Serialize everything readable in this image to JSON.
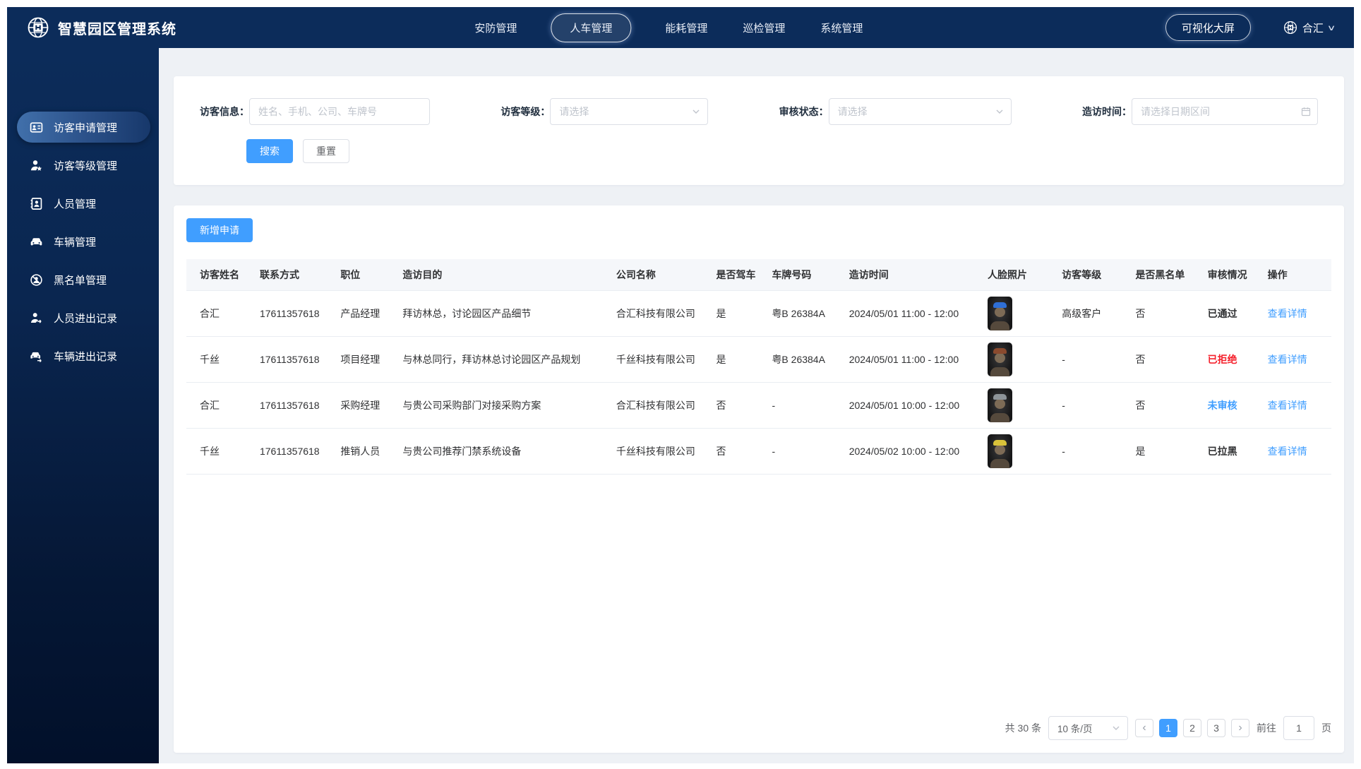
{
  "app": {
    "title": "智慧园区管理系统"
  },
  "colors": {
    "primary": "#409eff",
    "danger": "#f5222d",
    "navbar_bg": "#0c2c5a",
    "link": "#409eff"
  },
  "navbar": {
    "items": [
      {
        "label": "安防管理",
        "active": false
      },
      {
        "label": "人车管理",
        "active": true
      },
      {
        "label": "能耗管理",
        "active": false
      },
      {
        "label": "巡检管理",
        "active": false
      },
      {
        "label": "系统管理",
        "active": false
      }
    ],
    "big_screen_button": "可视化大屏",
    "user": {
      "name": "合汇"
    }
  },
  "sidebar": {
    "items": [
      {
        "label": "访客申请管理",
        "icon": "visitor-apply-icon",
        "active": true
      },
      {
        "label": "访客等级管理",
        "icon": "visitor-level-icon",
        "active": false
      },
      {
        "label": "人员管理",
        "icon": "personnel-icon",
        "active": false
      },
      {
        "label": "车辆管理",
        "icon": "vehicle-icon",
        "active": false
      },
      {
        "label": "黑名单管理",
        "icon": "blacklist-icon",
        "active": false
      },
      {
        "label": "人员进出记录",
        "icon": "person-record-icon",
        "active": false
      },
      {
        "label": "车辆进出记录",
        "icon": "vehicle-record-icon",
        "active": false
      }
    ]
  },
  "filters": {
    "visitor_info": {
      "label": "访客信息：",
      "placeholder": "姓名、手机、公司、车牌号"
    },
    "visitor_level": {
      "label": "访客等级：",
      "placeholder": "请选择"
    },
    "review_status": {
      "label": "审核状态：",
      "placeholder": "请选择"
    },
    "visit_time": {
      "label": "造访时间：",
      "placeholder": "请选择日期区间"
    },
    "search_label": "搜索",
    "reset_label": "重置"
  },
  "table": {
    "add_button": "新增申请",
    "columns": [
      "访客姓名",
      "联系方式",
      "职位",
      "造访目的",
      "公司名称",
      "是否驾车",
      "车牌号码",
      "造访时间",
      "人脸照片",
      "访客等级",
      "是否黑名单",
      "审核情况",
      "操作"
    ],
    "action_label": "查看详情",
    "rows": [
      {
        "name": "合汇",
        "phone": "17611357618",
        "position": "产品经理",
        "purpose": "拜访林总，讨论园区产品细节",
        "company": "合汇科技有限公司",
        "drive": "是",
        "plate": "粤B 26384A",
        "time": "2024/05/01 11:00 - 12:00",
        "level": "高级客户",
        "blacklist": "否",
        "status": "已通过",
        "status_color": "#303133",
        "photo_accent": "#2f6fd6"
      },
      {
        "name": "千丝",
        "phone": "17611357618",
        "position": "项目经理",
        "purpose": "与林总同行，拜访林总讨论园区产品规划",
        "company": "千丝科技有限公司",
        "drive": "是",
        "plate": "粤B 26384A",
        "time": "2024/05/01 11:00 - 12:00",
        "level": "-",
        "blacklist": "否",
        "status": "已拒绝",
        "status_color": "#f5222d",
        "photo_accent": "#8a4a2e"
      },
      {
        "name": "合汇",
        "phone": "17611357618",
        "position": "采购经理",
        "purpose": "与贵公司采购部门对接采购方案",
        "company": "合汇科技有限公司",
        "drive": "否",
        "plate": "-",
        "time": "2024/05/01 10:00 - 12:00",
        "level": "-",
        "blacklist": "否",
        "status": "未审核",
        "status_color": "#409eff",
        "photo_accent": "#8e9499"
      },
      {
        "name": "千丝",
        "phone": "17611357618",
        "position": "推销人员",
        "purpose": "与贵公司推荐门禁系统设备",
        "company": "千丝科技有限公司",
        "drive": "否",
        "plate": "-",
        "time": "2024/05/02 10:00 - 12:00",
        "level": "-",
        "blacklist": "是",
        "status": "已拉黑",
        "status_color": "#303133",
        "photo_accent": "#d9c23a"
      }
    ]
  },
  "pagination": {
    "total_label": "共 30 条",
    "page_size_label": "10 条/页",
    "prev_icon": "‹",
    "next_icon": "›",
    "pages": [
      "1",
      "2",
      "3"
    ],
    "active_page": "1",
    "goto_label": "前往",
    "goto_value": "1",
    "unit_label": "页"
  }
}
